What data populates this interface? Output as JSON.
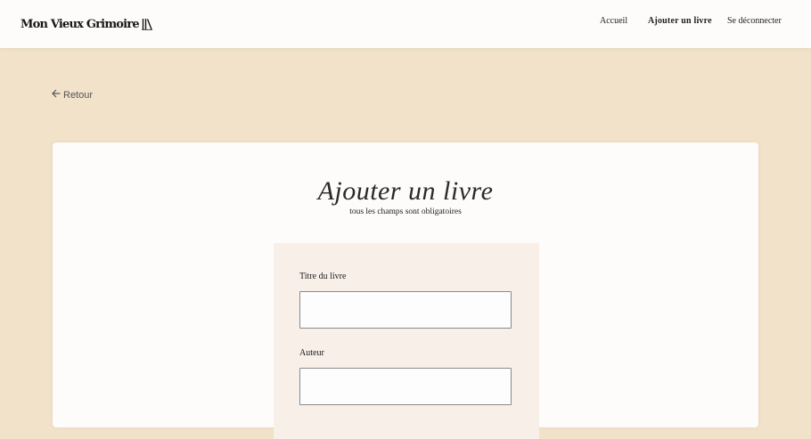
{
  "header": {
    "logo_text": "Mon Vieux Grimoire",
    "logo_icon": "books-icon",
    "nav": {
      "home": "Accueil",
      "add_book": "Ajouter un livre",
      "logout": "Se déconnecter"
    }
  },
  "back": {
    "label": "Retour",
    "icon": "arrow-left-icon"
  },
  "form": {
    "title": "Ajouter un livre",
    "subtitle": "tous les champs sont obligatoires",
    "fields": [
      {
        "label": "Titre du livre",
        "value": ""
      },
      {
        "label": "Auteur",
        "value": ""
      }
    ]
  },
  "colors": {
    "page_background": "#f1e2c9",
    "header_background": "#fdfcfb",
    "card_background": "#fdfcfb",
    "form_panel_background": "#f8efe9"
  }
}
